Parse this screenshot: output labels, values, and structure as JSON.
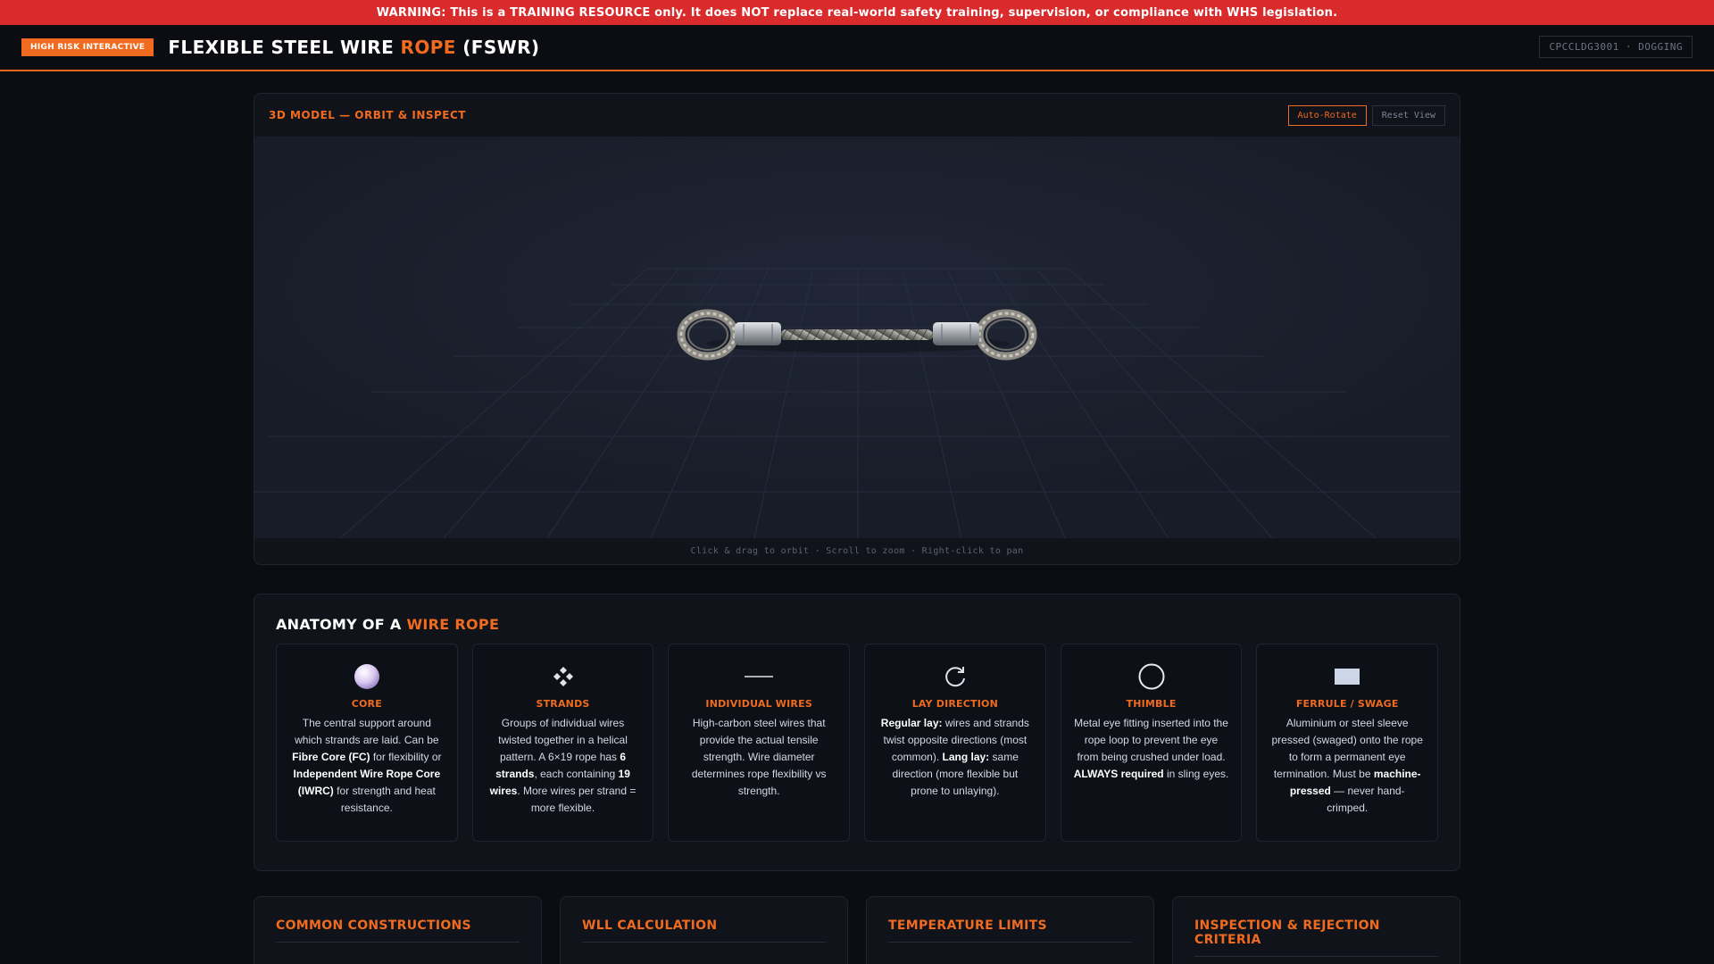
{
  "warning": "WARNING: This is a TRAINING RESOURCE only. It does NOT replace real-world safety training, supervision, or compliance with WHS legislation.",
  "header": {
    "badge": "HIGH RISK INTERACTIVE",
    "title_prefix": "FLEXIBLE STEEL WIRE ",
    "title_accent": "ROPE",
    "title_suffix": " (FSWR)",
    "course_code": "CPCCLDG3001 · DOGGING"
  },
  "viewer": {
    "title": "3D MODEL — ORBIT & INSPECT",
    "auto_rotate_label": "Auto-Rotate",
    "reset_view_label": "Reset View",
    "hint": "Click & drag to orbit · Scroll to zoom · Right-click to pan"
  },
  "anatomy": {
    "title_prefix": "ANATOMY OF A ",
    "title_accent": "WIRE ROPE",
    "cards": [
      {
        "icon": "sphere-icon",
        "name": "CORE",
        "parts": [
          {
            "t": "The central support around which strands are laid. Can be "
          },
          {
            "t": "Fibre Core (FC)",
            "b": true
          },
          {
            "t": " for flexibility or "
          },
          {
            "t": "Independent Wire Rope Core (IWRC)",
            "b": true
          },
          {
            "t": " for strength and heat resistance."
          }
        ]
      },
      {
        "icon": "diamond-cluster-icon",
        "name": "STRANDS",
        "parts": [
          {
            "t": "Groups of individual wires twisted together in a helical pattern. A 6×19 rope has "
          },
          {
            "t": "6 strands",
            "b": true
          },
          {
            "t": ", each containing "
          },
          {
            "t": "19 wires",
            "b": true
          },
          {
            "t": ". More wires per strand = more flexible."
          }
        ]
      },
      {
        "icon": "wire-line-icon",
        "name": "INDIVIDUAL WIRES",
        "parts": [
          {
            "t": "High-carbon steel wires that provide the actual tensile strength. Wire diameter determines rope flexibility vs strength."
          }
        ]
      },
      {
        "icon": "rotate-arrow-icon",
        "name": "LAY DIRECTION",
        "parts": [
          {
            "t": "Regular lay:",
            "b": true
          },
          {
            "t": " wires and strands twist opposite directions (most common). "
          },
          {
            "t": "Lang lay:",
            "b": true
          },
          {
            "t": " same direction (more flexible but prone to unlaying)."
          }
        ]
      },
      {
        "icon": "ring-icon",
        "name": "THIMBLE",
        "parts": [
          {
            "t": "Metal eye fitting inserted into the rope loop to prevent the eye from being crushed under load. "
          },
          {
            "t": "ALWAYS required",
            "b": true
          },
          {
            "t": " in sling eyes."
          }
        ]
      },
      {
        "icon": "sleeve-block-icon",
        "name": "FERRULE / SWAGE",
        "parts": [
          {
            "t": "Aluminium or steel sleeve pressed (swaged) onto the rope to form a permanent eye termination. Must be "
          },
          {
            "t": "machine-pressed",
            "b": true
          },
          {
            "t": " — never hand-crimped."
          }
        ]
      }
    ]
  },
  "bottom_panels": [
    {
      "title": "COMMON CONSTRUCTIONS"
    },
    {
      "title": "WLL CALCULATION"
    },
    {
      "title": "TEMPERATURE LIMITS"
    },
    {
      "title": "INSPECTION & REJECTION CRITERIA"
    }
  ],
  "colors": {
    "accent": "#f06b1f",
    "warning": "#d92b2b",
    "background": "#0b0d12",
    "panel": "#10131a",
    "viewport": "#1a1f2c"
  }
}
